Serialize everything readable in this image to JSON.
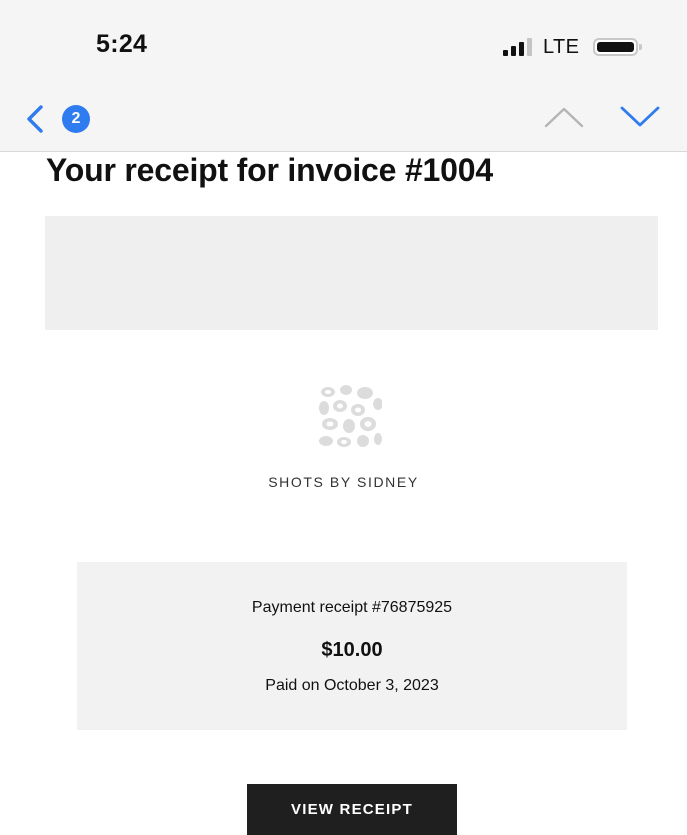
{
  "status_bar": {
    "time": "5:24",
    "network": "LTE",
    "icons": [
      "signal-icon",
      "battery-icon"
    ]
  },
  "nav": {
    "back_icon": "chevron-left-icon",
    "unread_count": "2",
    "prev_icon": "chevron-up-icon",
    "next_icon": "chevron-down-icon",
    "colors": {
      "accent": "#2f7bf0",
      "disabled": "#b5b5b5"
    }
  },
  "email": {
    "subject": "Your receipt for invoice #1004",
    "merchant": {
      "logo_icon": "leopard-print-logo",
      "name": "SHOTS BY SIDNEY"
    },
    "receipt": {
      "number": "Payment receipt #76875925",
      "amount": "$10.00",
      "paid_on": "Paid on October 3, 2023"
    },
    "view_receipt_label": "VIEW RECEIPT",
    "colors": {
      "button": "#1f1f1f",
      "card": "#f2f2f2",
      "banner": "#efefef"
    }
  }
}
